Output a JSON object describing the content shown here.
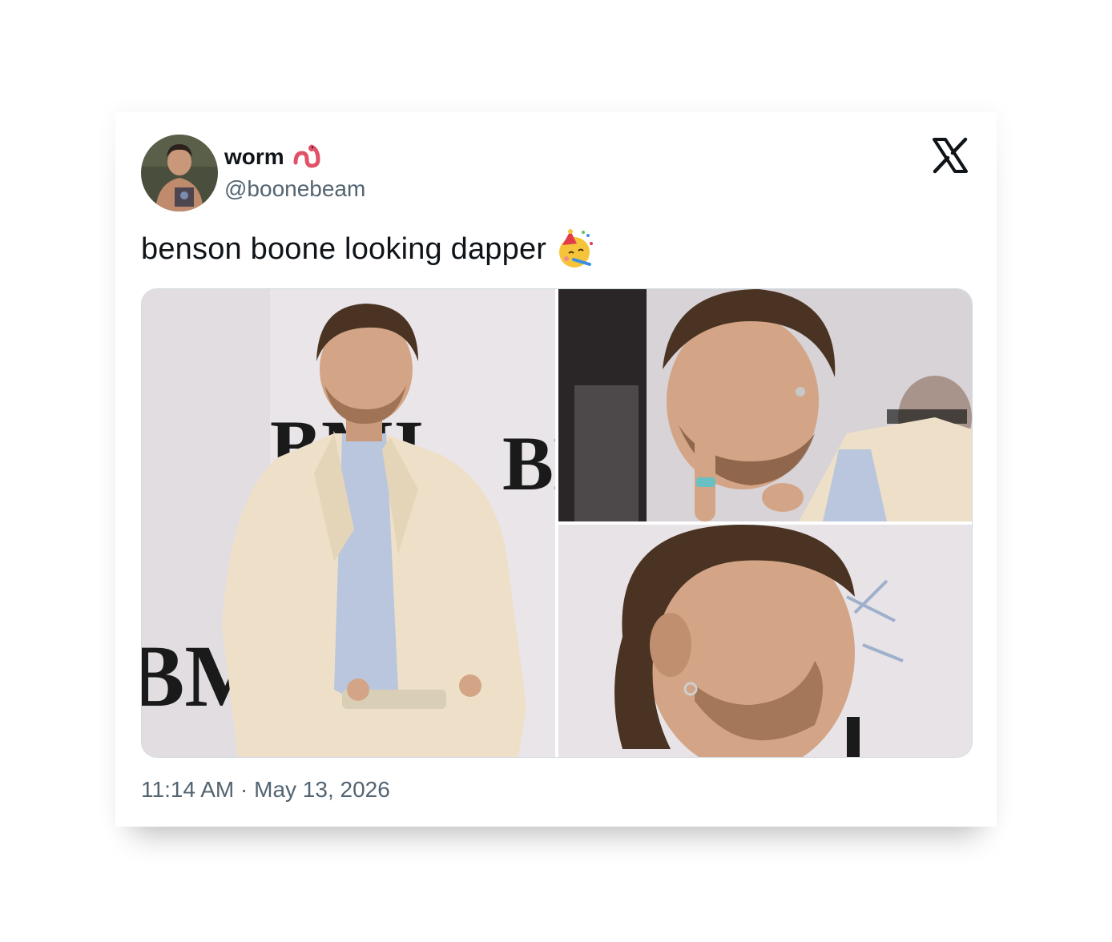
{
  "tweet": {
    "author": {
      "display_name": "worm",
      "name_emoji": "worm-emoji",
      "handle": "@boonebeam",
      "avatar_icon": "avatar-photo"
    },
    "platform_icon": "x-logo-icon",
    "text": "benson boone looking dapper",
    "text_emoji": "partying-face-emoji",
    "media": [
      {
        "icon": "photo-full-body-red-carpet",
        "caption": "BMI"
      },
      {
        "icon": "photo-finger-to-lip-closeup"
      },
      {
        "icon": "photo-smiling-side-profile"
      }
    ],
    "time": "11:14 AM",
    "separator": "·",
    "date": "May 13, 2026"
  },
  "colors": {
    "text_primary": "#0f1419",
    "text_secondary": "#536471",
    "border": "#cfd9de",
    "suit": "#eee0c8",
    "shirt": "#b9c6dd",
    "backdrop": "#e7e3e6"
  }
}
